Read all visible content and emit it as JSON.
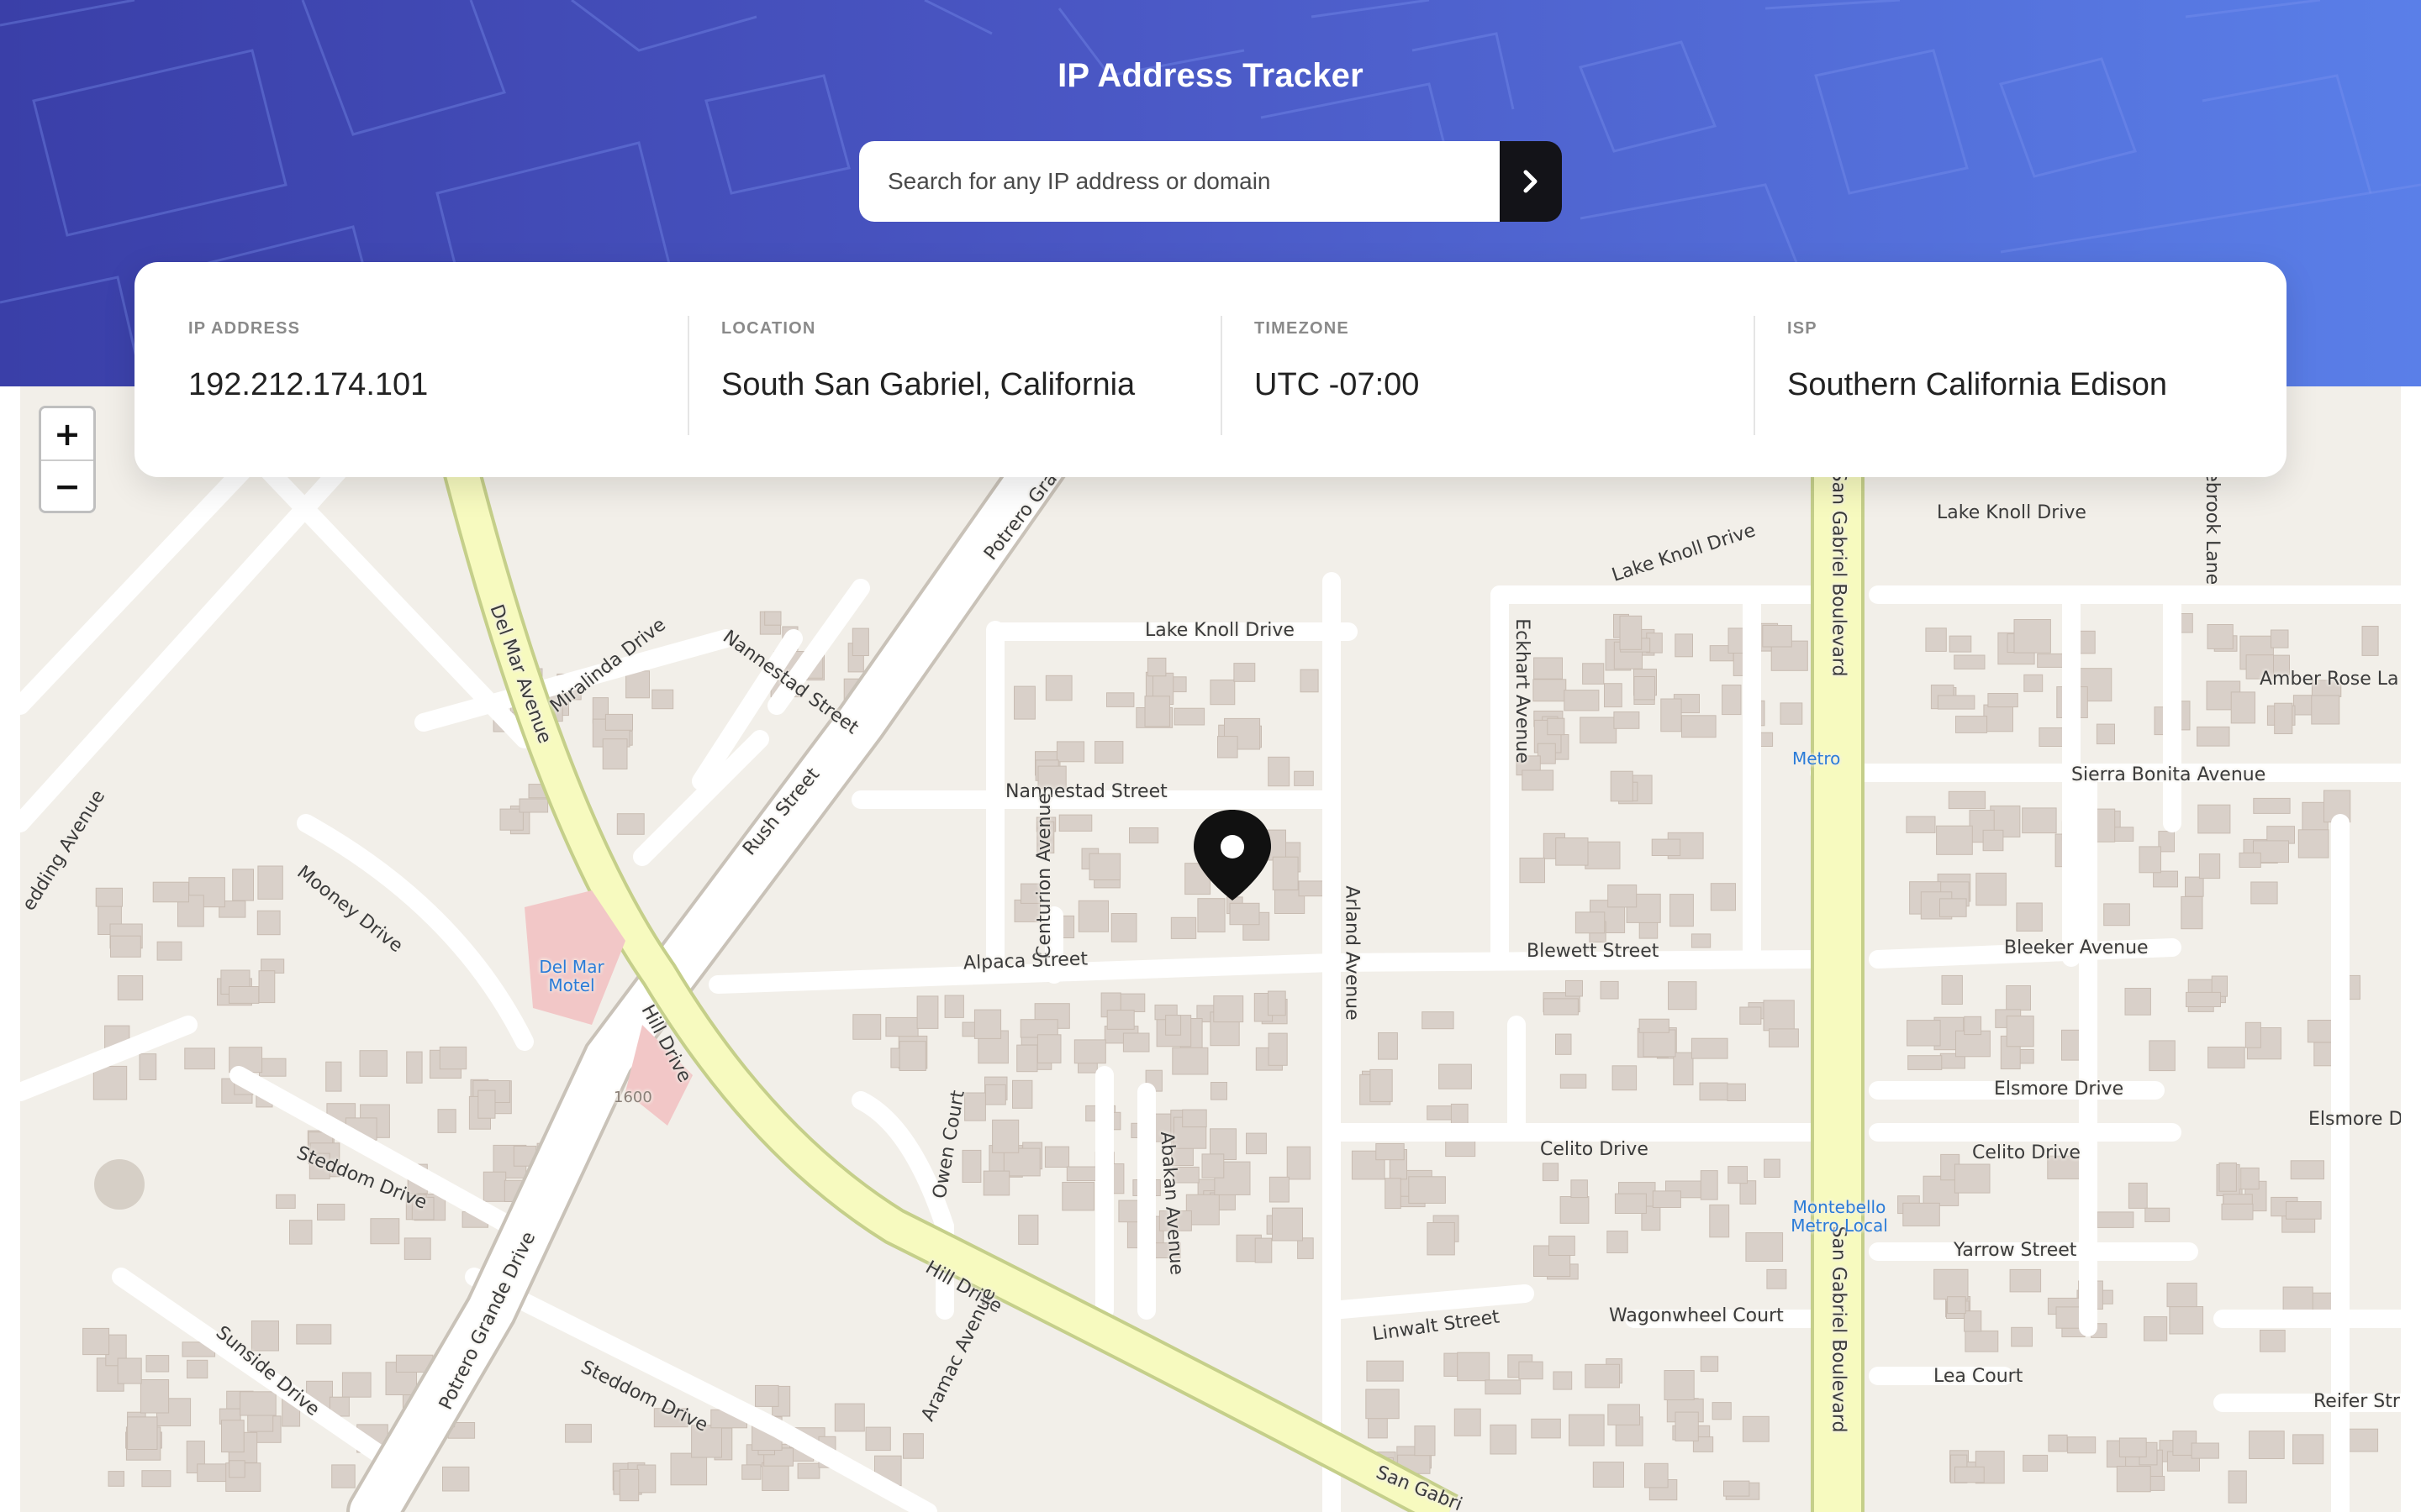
{
  "header": {
    "title": "IP Address Tracker",
    "search_placeholder": "Search for any IP address or domain"
  },
  "info": [
    {
      "label": "IP ADDRESS",
      "value": "192.212.174.101"
    },
    {
      "label": "LOCATION",
      "value": "South San Gabriel, California"
    },
    {
      "label": "TIMEZONE",
      "value": "UTC -07:00"
    },
    {
      "label": "ISP",
      "value": "Southern California Edison"
    }
  ],
  "map": {
    "zoom_in": "+",
    "zoom_out": "−",
    "streets": {
      "lake_knoll_drive_1": "Lake Knoll Drive",
      "lake_knoll_drive_2": "Lake Knoll Drive",
      "lake_knoll_drive_3": "Lake Knoll Drive",
      "nannestad_street_1": "Nannestad Street",
      "nannestad_street_2": "Nannestad Street",
      "alpaca_street": "Alpaca Street",
      "blewett_street": "Blewett Street",
      "bleeker_avenue": "Bleeker Avenue",
      "centurion_avenue": "Centurion Avenue",
      "arland_avenue": "Arland Avenue",
      "eckhart_avenue": "Eckhart Avenue",
      "san_gabriel_boulevard_1": "San Gabriel Boulevard",
      "san_gabriel_boulevard_2": "San Gabriel Boulevard",
      "sierra_bonita_avenue": "Sierra Bonita Avenue",
      "amber_rose_lane": "Amber Rose La",
      "elsmore_drive_1": "Elsmore Drive",
      "elsmore_drive_2": "Elsmore Dr",
      "celito_drive_1": "Celito Drive",
      "celito_drive_2": "Celito Drive",
      "yarrow_street": "Yarrow Street",
      "wagonwheel_court": "Wagonwheel Court",
      "linwalt_street": "Linwalt Street",
      "lea_court": "Lea Court",
      "reifer_street": "Reifer Str",
      "del_mar_avenue": "Del Mar Avenue",
      "miralinda_drive": "Miralinda Drive",
      "rush_street": "Rush Street",
      "potrero_grande_1": "Potrero Grande",
      "potrero_grande_drive": "Potrero Grande Drive",
      "mooney_drive": "Mooney Drive",
      "hill_drive_1": "Hill Drive",
      "hill_drive_2": "Hill Drive",
      "steddom_drive_1": "Steddom Drive",
      "steddom_drive_2": "Steddom Drive",
      "sunside_drive": "Sunside Drive",
      "owen_court": "Owen Court",
      "abakan_avenue": "Abakan Avenue",
      "aramac_avenue": "Aramac Avenue",
      "redding_avenue": "edding Avenue",
      "esebrook_lane": "sebrook Lane",
      "san_gabriel_3": "San Gabri"
    },
    "pois": {
      "del_mar_motel": "Del Mar Motel",
      "metro": "Metro",
      "montebello_metro_local": "Montebello Metro Local",
      "house_number": "1600"
    },
    "colors": {
      "land": "#f2efe9",
      "building": "#d9d0c9",
      "primary_road": "#f7fabf",
      "primary_road_casing": "#c5cf8a",
      "road": "#ffffff",
      "poi": "#2a7bd8"
    }
  }
}
